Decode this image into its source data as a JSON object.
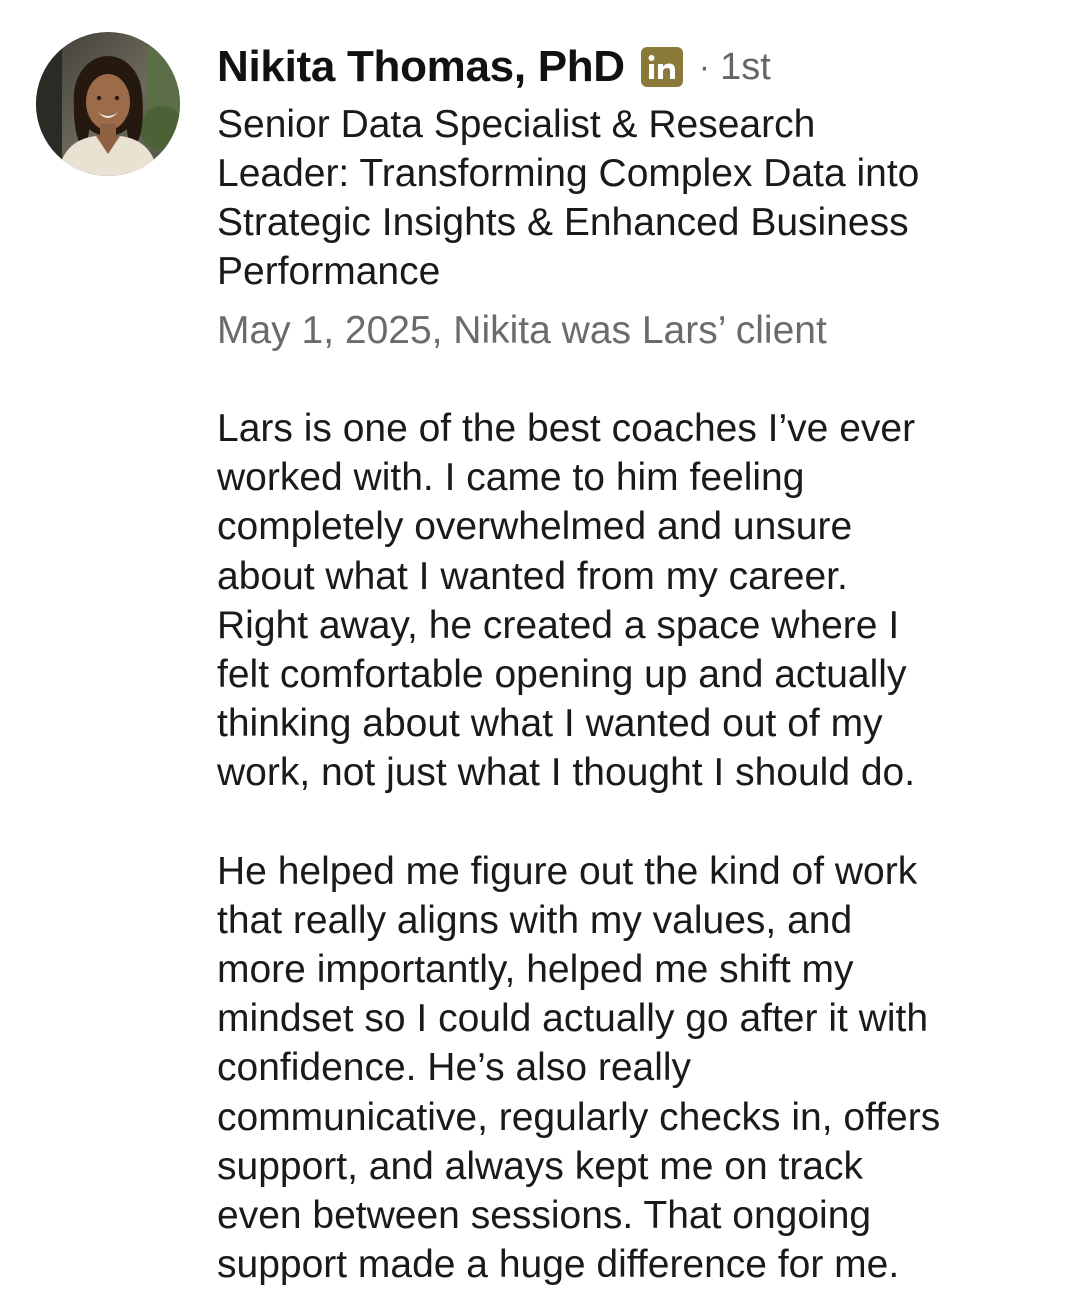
{
  "recommendation": {
    "author": {
      "name": "Nikita Thomas, PhD",
      "connection_degree": "1st",
      "separator": "·",
      "badge_icon": "linkedin-icon",
      "headline_lines": [
        "Senior Data Specialist & Research",
        "Leader: Transforming Complex Data into",
        "Strategic Insights & Enhanced Business",
        "Performance"
      ]
    },
    "meta": "May 1, 2025, Nikita was Lars’ client",
    "paragraphs": [
      {
        "lines": [
          "Lars is one of the best coaches I’ve ever",
          "worked with. I came to him feeling",
          "completely overwhelmed and unsure",
          "about what I wanted from my career.",
          "Right away, he created a space where I",
          "felt comfortable opening up and actually",
          "thinking about what I wanted out of my",
          "work, not just what I thought I should do."
        ]
      },
      {
        "lines": [
          "He helped me figure out the kind of work",
          "that really aligns with my values, and",
          "more importantly, helped me shift my",
          "mindset so I could actually go after it with",
          "confidence. He’s also really",
          "communicative, regularly checks in, offers",
          "support, and always kept me on track",
          "even between sessions. That ongoing",
          "support made a huge difference for me."
        ]
      }
    ]
  },
  "colors": {
    "text_primary": "#1a1a1a",
    "text_secondary": "#6b6b6b",
    "badge_background": "#8a7a3a"
  }
}
